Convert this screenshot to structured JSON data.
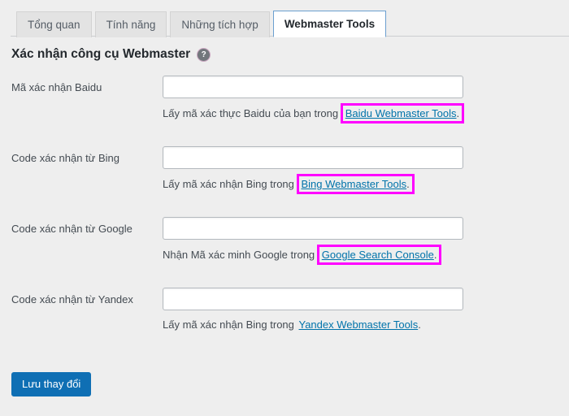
{
  "colors": {
    "page_background": "#eeeeee",
    "accent_link": "#0073aa",
    "primary_button": "#0f6fb4",
    "highlight_box": "#ff00ff",
    "active_tab_border": "#6b9fd0"
  },
  "tabs": [
    {
      "label": "Tổng quan",
      "active": false
    },
    {
      "label": "Tính năng",
      "active": false
    },
    {
      "label": "Những tích hợp",
      "active": false
    },
    {
      "label": "Webmaster Tools",
      "active": true
    }
  ],
  "heading": {
    "title": "Xác nhận công cụ Webmaster",
    "help_icon": "help-circle-icon",
    "help_icon_glyph": "?"
  },
  "fields": [
    {
      "label": "Mã xác nhận Baidu",
      "value": "",
      "placeholder": "",
      "description_prefix": "Lấy mã xác thực Baidu của bạn trong ",
      "link_text": "Baidu Webmaster Tools",
      "description_suffix": ".",
      "highlighted": true
    },
    {
      "label": "Code xác nhận từ Bing",
      "value": "",
      "placeholder": "",
      "description_prefix": "Lấy mã xác nhận Bing trong ",
      "link_text": "Bing Webmaster Tools",
      "description_suffix": ".",
      "highlighted": true
    },
    {
      "label": "Code xác nhận từ Google",
      "value": "",
      "placeholder": "",
      "description_prefix": "Nhận Mã xác minh Google trong ",
      "link_text": "Google Search Console",
      "description_suffix": ".",
      "highlighted": true
    },
    {
      "label": "Code xác nhận từ Yandex",
      "value": "",
      "placeholder": "",
      "description_prefix": "Lấy mã xác nhận Bing trong ",
      "link_text": "Yandex Webmaster Tools",
      "description_suffix": ".",
      "highlighted": false
    }
  ],
  "submit": {
    "label": "Lưu thay đổi"
  }
}
